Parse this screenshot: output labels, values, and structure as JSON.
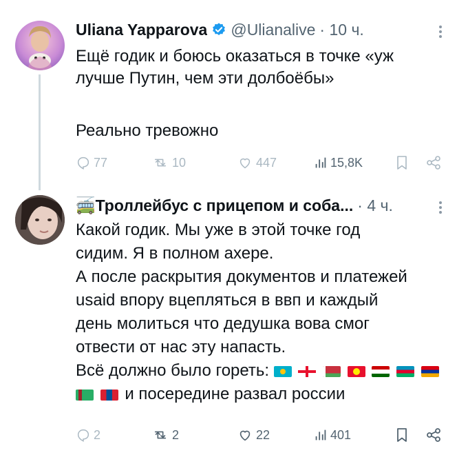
{
  "tweet1": {
    "author_name": "Uliana Yapparova",
    "handle": "@Ulianalive",
    "time": "· 10 ч.",
    "text_lines": [
      "Ещё годик и боюсь оказаться в точке «уж",
      "лучше Путин, чем эти долбоёбы»"
    ],
    "text_line_2": "Реально тревожно",
    "replies": "77",
    "reposts": "10",
    "likes": "447",
    "views": "15,8K"
  },
  "tweet2": {
    "author_name": "🚎Троллейбус с прицепом и соба...",
    "time": "· 4 ч.",
    "lines": [
      "Какой годик. Мы уже в этой точке год",
      "сидим. Я в полном ахере.",
      "А после раскрытия документов и платежей",
      "usaid впору вцепляться в ввп и каждый",
      "день молиться что дедушка вова смог",
      "отвести от нас эту напасть.",
      "Всё должно было гореть:",
      "и посередине развал россии"
    ],
    "flags_row1": [
      "kazakhstan",
      "georgia",
      "belarus",
      "kyrgyzstan",
      "tajikistan",
      "azerbaijan",
      "armenia"
    ],
    "flags_row2": [
      "turkmenistan",
      "mongolia"
    ],
    "replies": "2",
    "reposts": "2",
    "likes": "22",
    "views": "401"
  },
  "icons": {
    "reply": "reply-icon",
    "repost": "repost-icon",
    "like": "heart-icon",
    "views": "views-icon",
    "bookmark": "bookmark-icon",
    "share": "share-icon",
    "verified": "verified-badge-icon",
    "more": "more-icon"
  },
  "colors": {
    "text": "#0f1419",
    "muted": "#536471",
    "faded": "#aab8c2",
    "verified": "#1d9bf0"
  }
}
